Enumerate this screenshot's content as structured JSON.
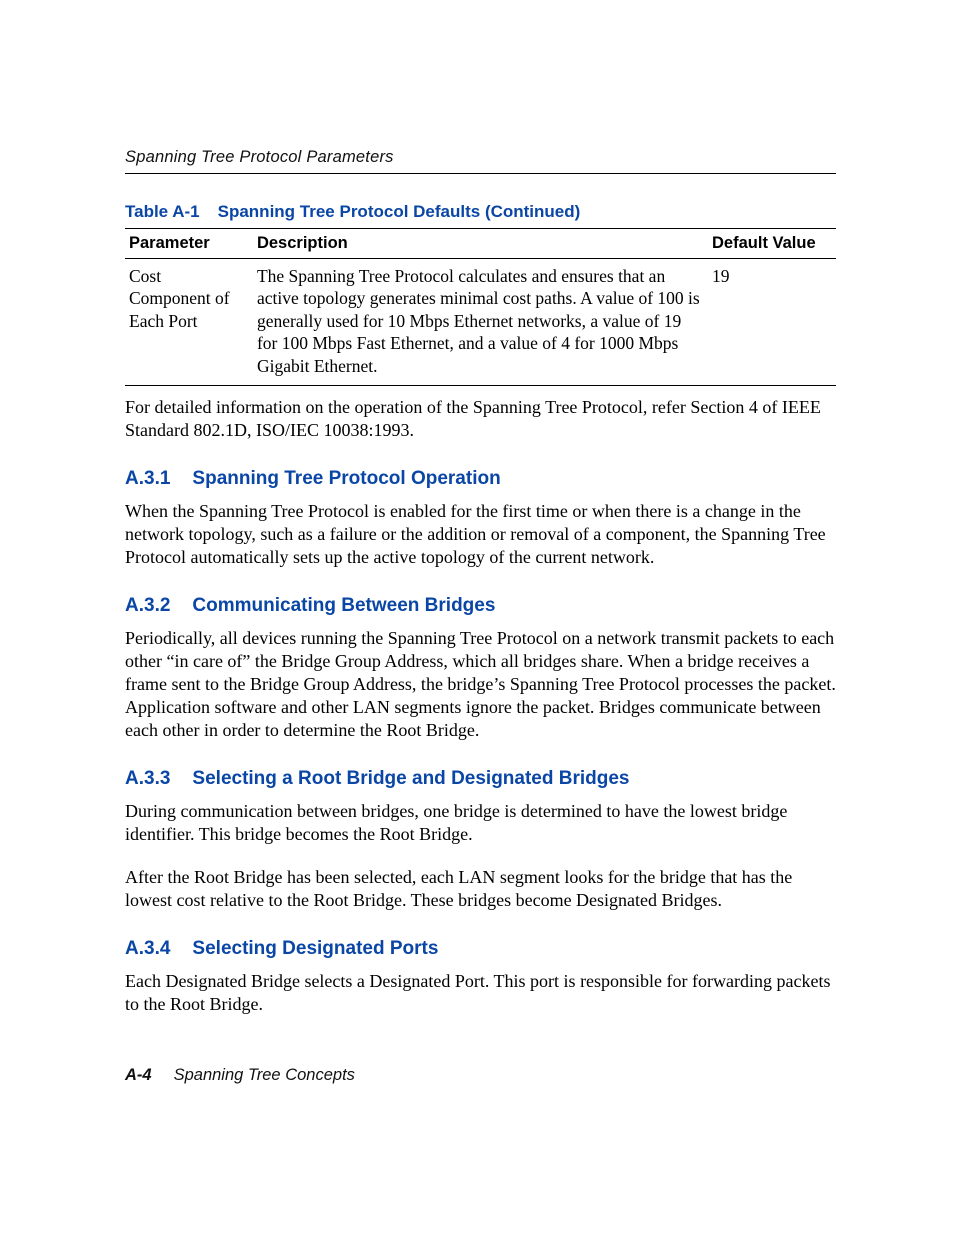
{
  "header": {
    "running_title": "Spanning Tree Protocol Parameters"
  },
  "table": {
    "caption_label": "Table A-1",
    "caption_title": "Spanning Tree Protocol Defaults (Continued)",
    "columns": {
      "param": "Parameter",
      "desc": "Description",
      "def": "Default Value"
    },
    "rows": [
      {
        "param": "Cost Component of Each Port",
        "desc": "The Spanning Tree Protocol calculates and ensures that an active topology generates minimal cost paths. A value of 100 is generally used for 10 Mbps Ethernet networks, a value of 19 for 100 Mbps Fast Ethernet, and a value of 4 for 1000 Mbps Gigabit Ethernet.",
        "def": "19"
      }
    ]
  },
  "post_table_paragraph": "For detailed information on the operation of the Spanning Tree Protocol, refer Section 4 of IEEE Standard 802.1D, ISO/IEC 10038:1993.",
  "sections": [
    {
      "number": "A.3.1",
      "title": "Spanning Tree Protocol Operation",
      "paragraphs": [
        "When the Spanning Tree Protocol is enabled for the first time or when there is a change in the network topology, such as a failure or the addition or removal of a component, the Spanning Tree Protocol automatically sets up the active topology of the current network."
      ]
    },
    {
      "number": "A.3.2",
      "title": "Communicating Between Bridges",
      "paragraphs": [
        "Periodically, all devices running the Spanning Tree Protocol on a network transmit packets to each other “in care of” the Bridge Group Address, which all bridges share. When a bridge receives a frame sent to the Bridge Group Address, the bridge’s Spanning Tree Protocol processes the packet. Application software and other LAN segments ignore the packet. Bridges communicate between each other in order to determine the Root Bridge."
      ]
    },
    {
      "number": "A.3.3",
      "title": "Selecting a Root Bridge and Designated Bridges",
      "paragraphs": [
        "During communication between bridges, one bridge is determined to have the lowest bridge identifier. This bridge becomes the Root Bridge.",
        "After the Root Bridge has been selected, each LAN segment looks for the bridge that has the lowest cost relative to the Root Bridge. These bridges become Designated Bridges."
      ]
    },
    {
      "number": "A.3.4",
      "title": "Selecting Designated Ports",
      "paragraphs": [
        "Each Designated Bridge selects a Designated Port. This port is responsible for forwarding packets to the Root Bridge."
      ]
    }
  ],
  "footer": {
    "page_number": "A-4",
    "chapter_title": "Spanning Tree Concepts"
  }
}
